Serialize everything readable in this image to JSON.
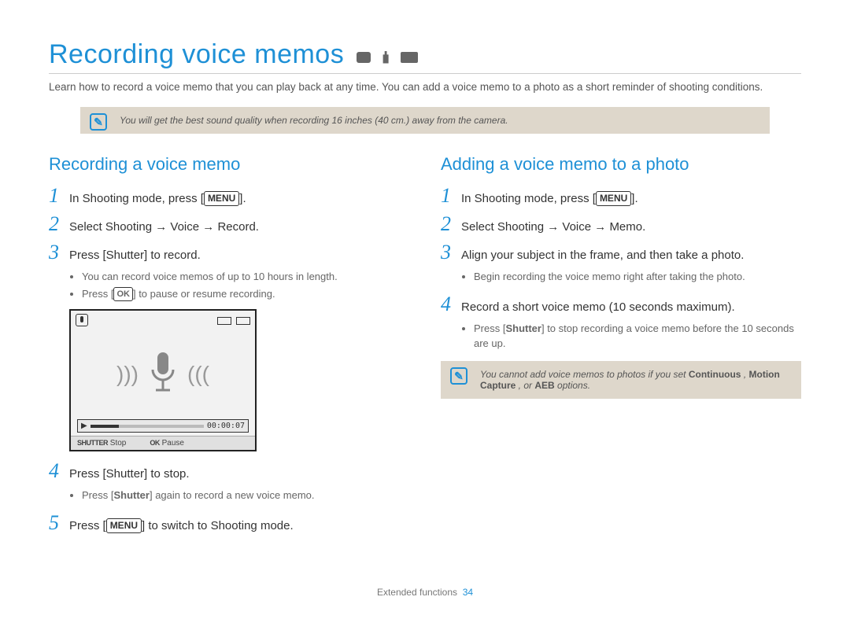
{
  "page": {
    "title": "Recording voice memos",
    "intro": "Learn how to record a voice memo that you can play back at any time. You can add a voice memo to a photo as a short reminder of shooting conditions.",
    "top_note": "You will get the best sound quality when recording 16 inches (40 cm.) away from the camera.",
    "footer_text": "Extended functions",
    "page_number": "34"
  },
  "left": {
    "heading": "Recording a voice memo",
    "step1_pre": "In Shooting mode, press [",
    "step1_btn": "MENU",
    "step1_post": "].",
    "step2": "Select Shooting → Voice → Record.",
    "step3": "Press [Shutter] to record.",
    "step3_sub1": "You can record voice memos of up to 10 hours in length.",
    "step3_sub2_pre": "Press [",
    "step3_sub2_btn": "OK",
    "step3_sub2_post": "] to pause or resume recording.",
    "screen": {
      "time": "00:00:07",
      "shutter_label": "SHUTTER",
      "stop": "Stop",
      "ok_label": "OK",
      "pause": "Pause"
    },
    "step4": "Press [Shutter] to stop.",
    "step4_sub1_pre": "Press [",
    "step4_sub1_bold": "Shutter",
    "step4_sub1_post": "] again to record a new voice memo.",
    "step5_pre": "Press [",
    "step5_btn": "MENU",
    "step5_post": "] to switch to Shooting mode."
  },
  "right": {
    "heading": "Adding a voice memo to a photo",
    "step1_pre": "In Shooting mode, press [",
    "step1_btn": "MENU",
    "step1_post": "].",
    "step2": "Select Shooting → Voice → Memo.",
    "step3": "Align your subject in the frame, and then take a photo.",
    "step3_sub1": "Begin recording the voice memo right after taking the photo.",
    "step4": "Record a short voice memo (10 seconds maximum).",
    "step4_sub1_pre": "Press [",
    "step4_sub1_bold": "Shutter",
    "step4_sub1_post": "] to stop recording a voice memo before the 10 seconds are up.",
    "note_pre": "You cannot add voice memos to photos if you set ",
    "note_b1": "Continuous",
    "note_mid1": " , ",
    "note_b2": "Motion Capture",
    "note_mid2": " , or ",
    "note_b3": "AEB",
    "note_post": " options."
  }
}
